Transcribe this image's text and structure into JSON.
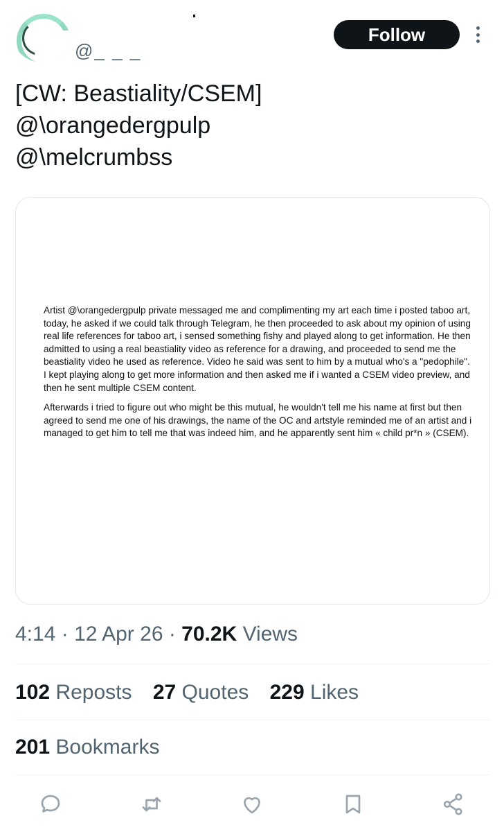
{
  "header": {
    "handle": "@_ _ _",
    "follow_label": "Follow"
  },
  "tweet": {
    "lines": [
      "[CW: Beastiality/CSEM]",
      "@\\orangedergpulp",
      "@\\melcrumbss"
    ]
  },
  "media": {
    "paragraphs": [
      "Artist @\\orangedergpulp private messaged me and complimenting my art each time i posted taboo art, today, he asked if we could talk through Telegram, he then proceeded to ask about my opinion of using real life references for taboo art, i sensed something fishy and played along to get information. He then admitted to using a real beastiality video as reference for a drawing, and proceeded to send me the beastiality video he used as reference. Video he said was sent to him by a mutual who's a \"pedophile\". I kept playing along to get more information and then asked me if i wanted a CSEM video preview, and then he sent multiple CSEM content.",
      "Afterwards i tried to figure out who might be this mutual, he wouldn't tell me his name at first but then agreed to send me one of his drawings, the name of the OC and artstyle reminded me of an artist and i managed to get him to tell me that was indeed him, and he apparently sent him « child pr*n » (CSEM)."
    ]
  },
  "meta": {
    "time": "4:14",
    "date": "12 Apr 26",
    "views_count": "70.2K",
    "views_label": "Views"
  },
  "stats": {
    "reposts_count": "102",
    "reposts_label": "Reposts",
    "quotes_count": "27",
    "quotes_label": "Quotes",
    "likes_count": "229",
    "likes_label": "Likes",
    "bookmarks_count": "201",
    "bookmarks_label": "Bookmarks"
  },
  "actions": [
    "reply-icon",
    "repost-icon",
    "like-icon",
    "bookmark-icon",
    "share-icon"
  ],
  "colors": {
    "text": "#0f1419",
    "muted": "#536471",
    "icon": "#9aa5ad",
    "button": "#0f1419",
    "avatar_accent": "#8fd7bf"
  }
}
